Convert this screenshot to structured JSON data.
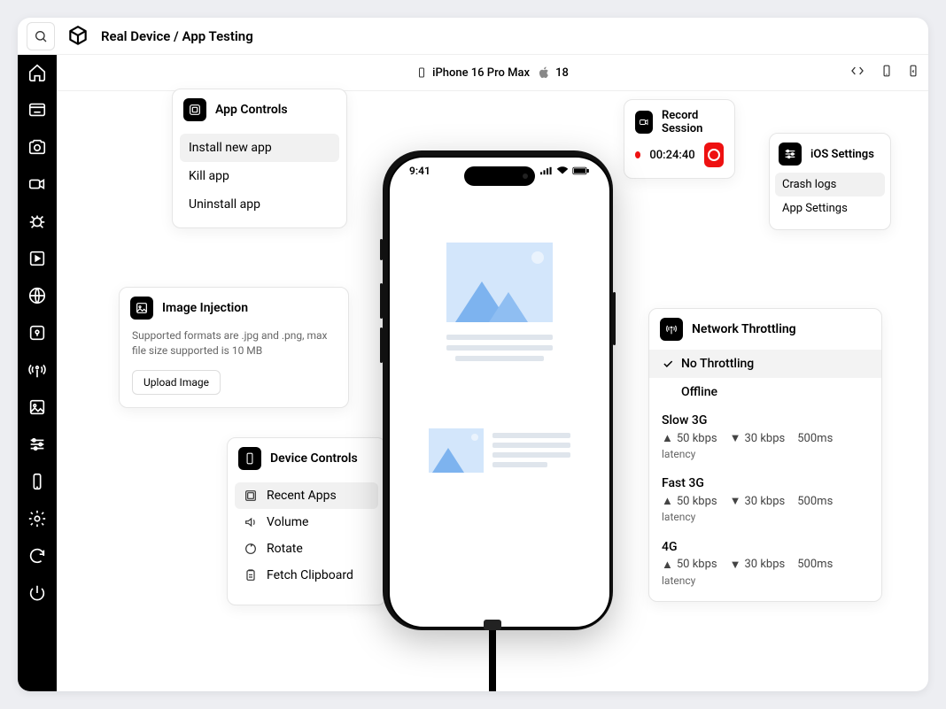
{
  "header": {
    "title": "Real Device / App Testing"
  },
  "deviceBar": {
    "device": "iPhone 16 Pro Max",
    "osVersion": "18"
  },
  "phone": {
    "clock": "9:41"
  },
  "appControls": {
    "title": "App Controls",
    "items": [
      "Install new app",
      "Kill app",
      "Uninstall app"
    ]
  },
  "imageInjection": {
    "title": "Image Injection",
    "description": "Supported formats are .jpg and .png, max file size supported is 10 MB",
    "button": "Upload Image"
  },
  "deviceControls": {
    "title": "Device Controls",
    "items": [
      "Recent Apps",
      "Volume",
      "Rotate",
      "Fetch Clipboard"
    ]
  },
  "record": {
    "title": "Record Session",
    "time": "00:24:40"
  },
  "iosSettings": {
    "title": "iOS Settings",
    "items": [
      "Crash logs",
      "App Settings"
    ]
  },
  "network": {
    "title": "Network Throttling",
    "noThrottle": "No Throttling",
    "offline": "Offline",
    "latencyLabel": "latency",
    "profiles": [
      {
        "name": "Slow 3G",
        "up": "50 kbps",
        "down": "30 kbps",
        "latency": "500ms"
      },
      {
        "name": "Fast 3G",
        "up": "50 kbps",
        "down": "30 kbps",
        "latency": "500ms"
      },
      {
        "name": "4G",
        "up": "50 kbps",
        "down": "30 kbps",
        "latency": "500ms"
      }
    ]
  }
}
